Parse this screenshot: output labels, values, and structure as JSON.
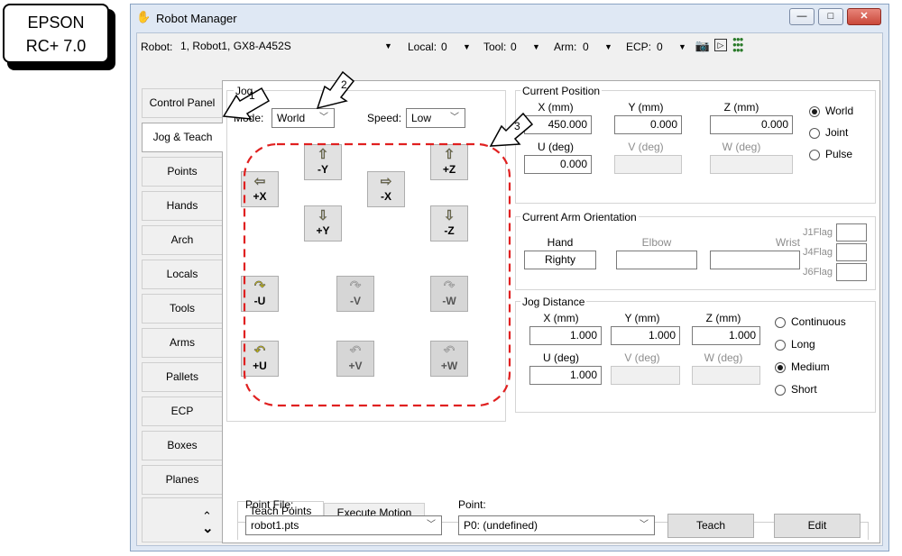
{
  "badge": {
    "line1": "EPSON",
    "line2": "RC+ 7.0"
  },
  "window": {
    "title": "Robot Manager",
    "minimize": "—",
    "maximize": "□",
    "close": "✕"
  },
  "toolbar": {
    "robot_label": "Robot:",
    "robot_value": "1, Robot1, GX8-A452S",
    "local_label": "Local:",
    "local_value": "0",
    "tool_label": "Tool:",
    "tool_value": "0",
    "arm_label": "Arm:",
    "arm_value": "0",
    "ecp_label": "ECP:",
    "ecp_value": "0",
    "icons": [
      "camera-icon",
      "play-icon",
      "io-grid-icon"
    ]
  },
  "left_tabs": [
    "Control Panel",
    "Jog & Teach",
    "Points",
    "Hands",
    "Arch",
    "Locals",
    "Tools",
    "Arms",
    "Pallets",
    "ECP",
    "Boxes",
    "Planes"
  ],
  "active_tab": "Jog & Teach",
  "jog": {
    "group_label": "Jog",
    "mode_label": "Mode:",
    "mode_value": "World",
    "speed_label": "Speed:",
    "speed_value": "Low",
    "buttons": [
      {
        "icon": "⇧",
        "label": "-Y",
        "enabled": true
      },
      {
        "icon": "⇧",
        "label": "+Z",
        "enabled": true
      },
      {
        "icon": "⇦",
        "label": "+X",
        "enabled": true
      },
      {
        "icon": "⇨",
        "label": "-X",
        "enabled": true
      },
      {
        "icon": "⇩",
        "label": "+Y",
        "enabled": true
      },
      {
        "icon": "⇩",
        "label": "-Z",
        "enabled": true
      },
      {
        "icon": "↷",
        "label": "-U",
        "enabled": true
      },
      {
        "icon": "↷",
        "label": "-V",
        "enabled": false
      },
      {
        "icon": "↷",
        "label": "-W",
        "enabled": false
      },
      {
        "icon": "↶",
        "label": "+U",
        "enabled": true
      },
      {
        "icon": "↶",
        "label": "+V",
        "enabled": false
      },
      {
        "icon": "↶",
        "label": "+W",
        "enabled": false
      }
    ]
  },
  "current_position": {
    "label": "Current Position",
    "x_label": "X (mm)",
    "x": "450.000",
    "y_label": "Y (mm)",
    "y": "0.000",
    "z_label": "Z (mm)",
    "z": "0.000",
    "u_label": "U (deg)",
    "u": "0.000",
    "v_label": "V (deg)",
    "v": "",
    "w_label": "W (deg)",
    "w": "",
    "options": [
      "World",
      "Joint",
      "Pulse"
    ],
    "selected": "World"
  },
  "arm_orientation": {
    "label": "Current Arm Orientation",
    "hand_label": "Hand",
    "hand": "Righty",
    "elbow_label": "Elbow",
    "elbow": "",
    "wrist_label": "Wrist",
    "wrist": "",
    "flags": [
      "J1Flag",
      "J4Flag",
      "J6Flag"
    ]
  },
  "jog_distance": {
    "label": "Jog Distance",
    "x_label": "X (mm)",
    "x": "1.000",
    "y_label": "Y (mm)",
    "y": "1.000",
    "z_label": "Z (mm)",
    "z": "1.000",
    "u_label": "U (deg)",
    "u": "1.000",
    "v_label": "V (deg)",
    "v": "",
    "w_label": "W (deg)",
    "w": "",
    "options": [
      "Continuous",
      "Long",
      "Medium",
      "Short"
    ],
    "selected": "Medium"
  },
  "bottom_tabs": [
    "Teach Points",
    "Execute Motion"
  ],
  "teach": {
    "point_file_label": "Point File:",
    "point_file": "robot1.pts",
    "point_label": "Point:",
    "point": "P0: (undefined)",
    "teach_button": "Teach",
    "edit_button": "Edit"
  },
  "callouts": [
    "1",
    "2",
    "3"
  ],
  "scroll": {
    "up": "⌃",
    "down": "⌄"
  }
}
